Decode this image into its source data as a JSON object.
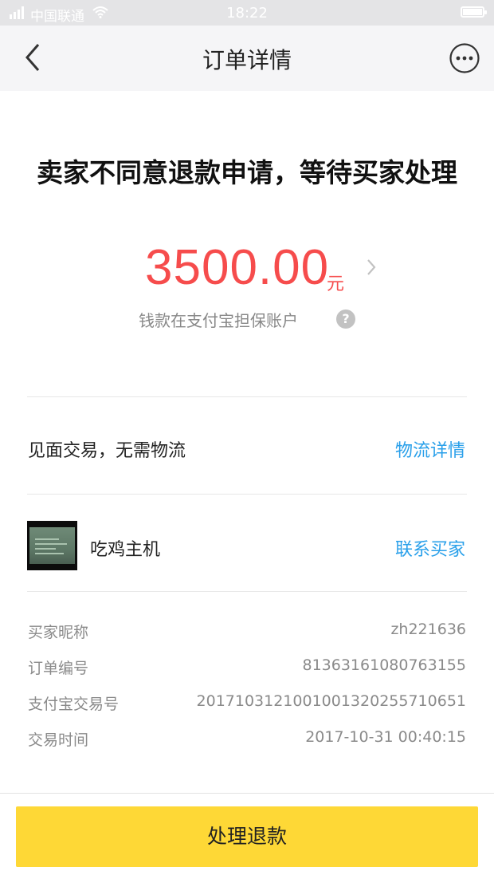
{
  "status_bar": {
    "carrier": "中国联通",
    "time": "18:22"
  },
  "nav": {
    "title": "订单详情",
    "back_icon": "chevron-left-icon",
    "more_icon": "more-horizontal-icon"
  },
  "order_status": {
    "headline": "卖家不同意退款申请，等待买家处理",
    "amount": "3500.00",
    "unit": "元",
    "escrow_note": "钱款在支付宝担保账户",
    "help_glyph": "?"
  },
  "logistics": {
    "text": "见面交易，无需物流",
    "link": "物流详情"
  },
  "item": {
    "name": "吃鸡主机",
    "link": "联系买家"
  },
  "info": {
    "buyer_nick_label": "买家昵称",
    "buyer_nick": "zh221636",
    "order_no_label": "订单编号",
    "order_no": "81363161080763155",
    "alipay_no_label": "支付宝交易号",
    "alipay_no": "2017103121001001320255710651",
    "time_label": "交易时间",
    "time": "2017-10-31 00:40:15"
  },
  "action": {
    "button": "处理退款"
  },
  "colors": {
    "amount": "#f64c4c",
    "link": "#2aa0ea",
    "button": "#fed836"
  }
}
